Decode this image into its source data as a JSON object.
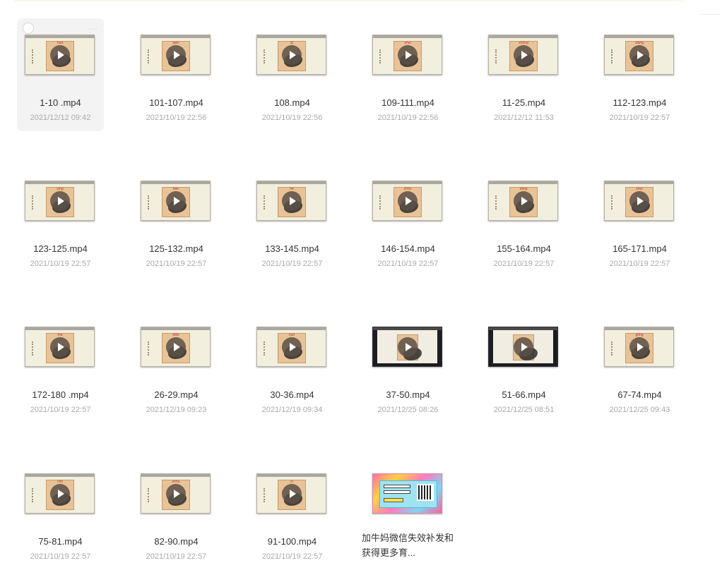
{
  "files": [
    {
      "name": "1-10 .mp4",
      "date": "2021/12/12 09:42",
      "pinyin": "huā",
      "kind": "video",
      "selected": true
    },
    {
      "name": "101-107.mp4",
      "date": "2021/10/19 22:56",
      "pinyin": "qián",
      "kind": "video"
    },
    {
      "name": "108.mp4",
      "date": "2021/10/19 22:56",
      "pinyin": "qī",
      "kind": "video"
    },
    {
      "name": "109-111.mp4",
      "date": "2021/10/19 22:56",
      "pinyin": "shuǐ",
      "kind": "video"
    },
    {
      "name": "11-25.mp4",
      "date": "2021/12/12 11:53",
      "pinyin": "zhōng",
      "kind": "video"
    },
    {
      "name": "112-123.mp4",
      "date": "2021/10/19 22:57",
      "pinyin": "wáng",
      "kind": "video"
    },
    {
      "name": "123-125.mp4",
      "date": "2021/10/19 22:57",
      "pinyin": "yīng",
      "kind": "video"
    },
    {
      "name": "125-132.mp4",
      "date": "2021/10/19 22:57",
      "pinyin": "tián",
      "kind": "video"
    },
    {
      "name": "133-145.mp4",
      "date": "2021/10/19 22:57",
      "pinyin": "hé",
      "kind": "video"
    },
    {
      "name": "146-154.mp4",
      "date": "2021/10/19 22:57",
      "pinyin": "zhōu",
      "kind": "video"
    },
    {
      "name": "155-164.mp4",
      "date": "2021/10/19 22:57",
      "pinyin": "sāng",
      "kind": "video"
    },
    {
      "name": "165-171.mp4",
      "date": "2021/10/19 22:57",
      "pinyin": "zhuī",
      "kind": "video"
    },
    {
      "name": "172-180 .mp4",
      "date": "2021/10/19 22:57",
      "pinyin": "mù",
      "kind": "video"
    },
    {
      "name": "26-29.mp4",
      "date": "2021/12/19 09:23",
      "pinyin": "diǎo",
      "kind": "video"
    },
    {
      "name": "30-36.mp4",
      "date": "2021/12/19 09:34",
      "pinyin": "huǒ",
      "kind": "video"
    },
    {
      "name": "37-50.mp4",
      "date": "2021/12/25 08:26",
      "pinyin": "",
      "kind": "dark"
    },
    {
      "name": "51-66.mp4",
      "date": "2021/12/25 08:51",
      "pinyin": "",
      "kind": "dark"
    },
    {
      "name": "67-74.mp4",
      "date": "2021/12/25 09:43",
      "pinyin": "gōng",
      "kind": "video"
    },
    {
      "name": "75-81.mp4",
      "date": "2021/10/19 22:57",
      "pinyin": "chē",
      "kind": "video"
    },
    {
      "name": "82-90.mp4",
      "date": "2021/10/19 22:57",
      "pinyin": "shǒu",
      "kind": "video"
    },
    {
      "name": "91-100.mp4",
      "date": "2021/10/19 22:57",
      "pinyin": "xī",
      "kind": "video"
    },
    {
      "name": "加牛妈微信失效补发和获得更多育...",
      "date": "",
      "pinyin": "",
      "kind": "promo"
    }
  ],
  "colors": {
    "selected_bg": "#f3f3f3",
    "name_text": "#333333",
    "date_text": "#aaaaaa",
    "paper": "#e8c397",
    "pinyin": "#c0392b"
  }
}
